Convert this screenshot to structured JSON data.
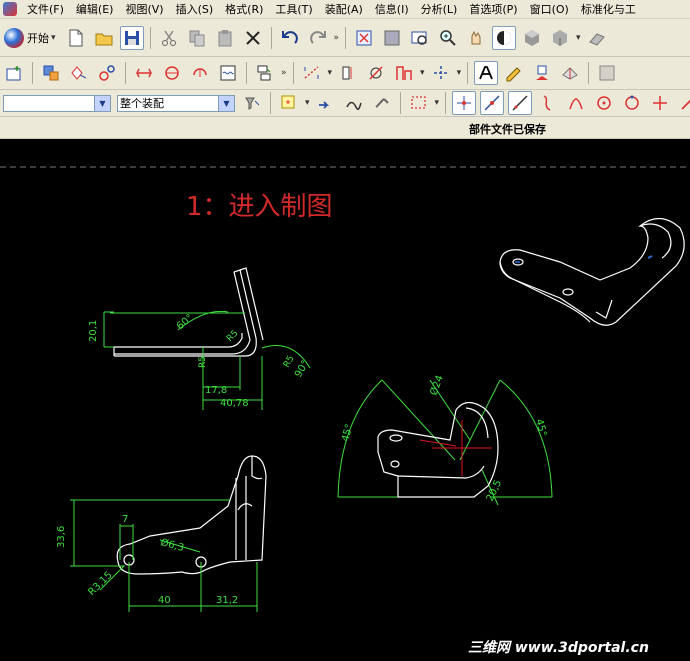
{
  "menubar": {
    "items": [
      "文件(F)",
      "编辑(E)",
      "视图(V)",
      "插入(S)",
      "格式(R)",
      "工具(T)",
      "装配(A)",
      "信息(I)",
      "分析(L)",
      "首选项(P)",
      "窗口(O)",
      "标准化与工"
    ]
  },
  "toolbar": {
    "start_label": "开始",
    "filter_select_value": "",
    "assembly_select_value": "整个装配",
    "overflow_glyph": "»"
  },
  "status": {
    "text": "部件文件已保存"
  },
  "canvas": {
    "headline": "1：进入制图",
    "watermark": "三维网 www.3dportal.cn",
    "dimensions": {
      "d_20_1": "20,1",
      "d_60deg": "60°",
      "d_r5_a": "R5",
      "d_r5_b": "R5",
      "d_r5_c": "R5",
      "d_90deg": "90°",
      "d_17_8": "17,8",
      "d_40_78": "40,78",
      "d_phi24": "Ø24",
      "d_45_left": "45°",
      "d_45_right": "45°",
      "d_20_5": "20,5",
      "d_33_6": "33,6",
      "d_7": "7",
      "d_phi6_3": "Ø6,3",
      "d_r3_15": "R3,15",
      "d_40": "40",
      "d_31_2": "31,2"
    }
  },
  "colors": {
    "dimension": "#3ee03e",
    "geometry": "#ffffff",
    "centerline": "#e0141e",
    "headline": "#d22a2a",
    "accent_blue": "#2a6fd6"
  }
}
